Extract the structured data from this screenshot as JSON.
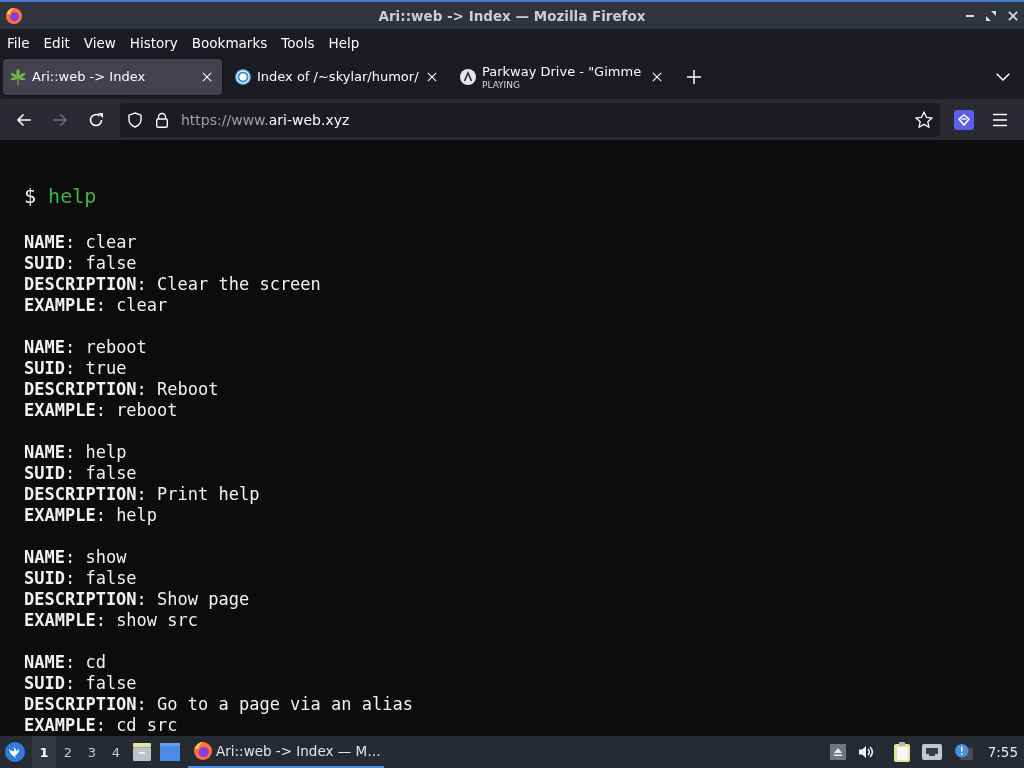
{
  "window": {
    "title": "Ari::web -> Index — Mozilla Firefox"
  },
  "menu_bar": [
    "File",
    "Edit",
    "View",
    "History",
    "Bookmarks",
    "Tools",
    "Help"
  ],
  "tabs": [
    {
      "title": "Ari::web -> Index",
      "selected": true
    },
    {
      "title": "Index of /~skylar/humor/",
      "selected": false
    },
    {
      "title": "Parkway Drive - \"Gimme",
      "subtitle": "PLAYING",
      "selected": false
    }
  ],
  "toolbar": {
    "forward_disabled": true,
    "url": {
      "prefix": "https://www.",
      "domain": "ari-web.xyz"
    }
  },
  "page": {
    "prompt": {
      "symbol": "$",
      "command": "help"
    },
    "entries": [
      {
        "lines": [
          "**NAME**: clear",
          "**SUID**: false",
          "**DESCRIPTION**: Clear the screen",
          "**EXAMPLE**: clear"
        ]
      },
      {
        "lines": [
          "**NAME**: reboot",
          "**SUID**: true",
          "**DESCRIPTION**: Reboot",
          "**EXAMPLE**: reboot"
        ]
      },
      {
        "lines": [
          "**NAME**: help",
          "**SUID**: false",
          "**DESCRIPTION**: Print help",
          "**EXAMPLE**: help"
        ]
      },
      {
        "lines": [
          "**NAME**: show",
          "**SUID**: false",
          "**DESCRIPTION**: Show page",
          "**EXAMPLE**: show src"
        ]
      },
      {
        "lines": [
          "**NAME**: cd",
          "**SUID**: false",
          "**DESCRIPTION**: Go to a page via an alias",
          "**EXAMPLE**: cd src"
        ]
      }
    ]
  },
  "taskbar": {
    "workspaces": [
      {
        "label": "1",
        "selected": true
      },
      {
        "label": "2",
        "selected": false
      },
      {
        "label": "3",
        "selected": false
      },
      {
        "label": "4",
        "selected": false
      }
    ],
    "tasks": [
      {
        "title": "Ari::web -> Index — M…",
        "selected": true
      }
    ],
    "clock": "7:55"
  }
}
